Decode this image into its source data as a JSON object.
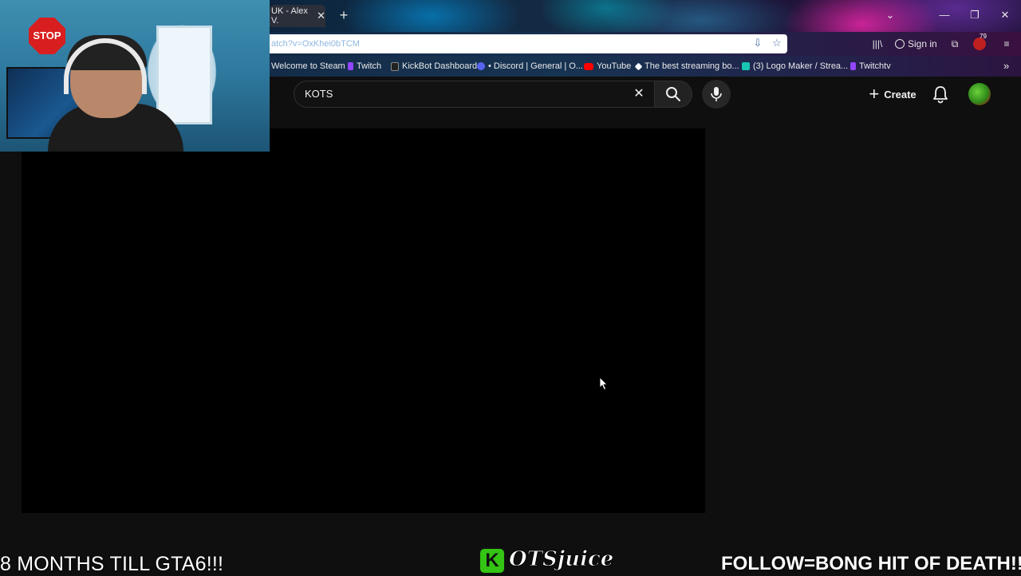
{
  "browser": {
    "active_tab_title": "UK - Alex V.",
    "url": "atch?v=OxKhei0bTCM",
    "sign_in_label": "Sign in",
    "extensions_badge": "79",
    "bookmarks": [
      {
        "label": "Welcome to Steam",
        "color": "#ffffff"
      },
      {
        "label": "Twitch",
        "color": "#9146ff"
      },
      {
        "label": "KickBot Dashboard",
        "color": "#222222"
      },
      {
        "label": "• Discord | General | O...",
        "color": "#5865f2"
      },
      {
        "label": "YouTube",
        "color": "#ff0000"
      },
      {
        "label": "The best streaming bo...",
        "color": "#ffffff"
      },
      {
        "label": "(3) Logo Maker / Strea...",
        "color": "#18c6b4"
      },
      {
        "label": "Twitchtv",
        "color": "#9146ff"
      }
    ]
  },
  "youtube": {
    "search_query": "KOTS",
    "create_label": "Create"
  },
  "overlay": {
    "left_text": "8 MONTHS TILL GTA6!!!",
    "logo_letter": "K",
    "brand_text": "OTSjuice",
    "right_text": "FOLLOW=BONG HIT OF DEATH!!!",
    "stop_sign_text": "STOP"
  },
  "colors": {
    "youtube_bg": "#0f0f0f",
    "player_bg": "#000000",
    "brand_green": "#33c414"
  }
}
